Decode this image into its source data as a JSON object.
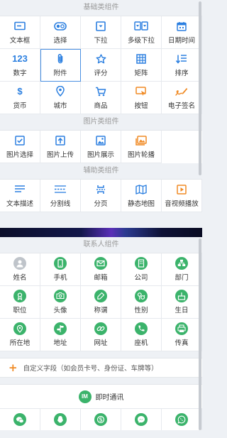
{
  "colors": {
    "accent_blue": "#2b7fe0",
    "accent_orange": "#f08a24",
    "contact_green": "#3bb36b",
    "selected_outline": "#4a90e2"
  },
  "sections": {
    "basic": {
      "title": "基础类组件",
      "items": [
        {
          "label": "文本框",
          "icon": "textbox-icon"
        },
        {
          "label": "选择",
          "icon": "select-toggle-icon"
        },
        {
          "label": "下拉",
          "icon": "dropdown-icon"
        },
        {
          "label": "多级下拉",
          "icon": "multilevel-dropdown-icon"
        },
        {
          "label": "日期时间",
          "icon": "calendar-icon"
        },
        {
          "label": "数字",
          "icon": "number-icon",
          "glyph": "123"
        },
        {
          "label": "附件",
          "icon": "paperclip-icon"
        },
        {
          "label": "评分",
          "icon": "star-icon"
        },
        {
          "label": "矩阵",
          "icon": "matrix-icon"
        },
        {
          "label": "排序",
          "icon": "sort-icon"
        },
        {
          "label": "货币",
          "icon": "currency-icon",
          "glyph": "$"
        },
        {
          "label": "城市",
          "icon": "location-pin-icon"
        },
        {
          "label": "商品",
          "icon": "cart-icon"
        },
        {
          "label": "按钮",
          "icon": "button-click-icon"
        },
        {
          "label": "电子签名",
          "icon": "signature-icon"
        }
      ]
    },
    "image": {
      "title": "图片类组件",
      "items": [
        {
          "label": "图片选择",
          "icon": "image-select-icon"
        },
        {
          "label": "图片上传",
          "icon": "image-upload-icon"
        },
        {
          "label": "图片展示",
          "icon": "image-display-icon"
        },
        {
          "label": "图片轮播",
          "icon": "image-carousel-icon"
        }
      ]
    },
    "aux": {
      "title": "辅助类组件",
      "items": [
        {
          "label": "文本描述",
          "icon": "text-description-icon"
        },
        {
          "label": "分割线",
          "icon": "divider-line-icon"
        },
        {
          "label": "分页",
          "icon": "pagination-icon"
        },
        {
          "label": "静态地图",
          "icon": "static-map-icon"
        },
        {
          "label": "音视频播放",
          "icon": "media-play-icon"
        }
      ]
    },
    "contact": {
      "title": "联系人组件",
      "items": [
        {
          "label": "姓名",
          "icon": "person-icon"
        },
        {
          "label": "手机",
          "icon": "mobile-phone-icon"
        },
        {
          "label": "邮箱",
          "icon": "mail-icon"
        },
        {
          "label": "公司",
          "icon": "company-icon"
        },
        {
          "label": "部门",
          "icon": "department-icon"
        },
        {
          "label": "职位",
          "icon": "position-icon"
        },
        {
          "label": "头像",
          "icon": "avatar-camera-icon"
        },
        {
          "label": "称谓",
          "icon": "title-icon"
        },
        {
          "label": "性别",
          "icon": "gender-icon"
        },
        {
          "label": "生日",
          "icon": "birthday-cake-icon"
        },
        {
          "label": "所在地",
          "icon": "current-location-icon"
        },
        {
          "label": "地址",
          "icon": "address-sign-icon"
        },
        {
          "label": "网址",
          "icon": "link-icon"
        },
        {
          "label": "座机",
          "icon": "landline-phone-icon"
        },
        {
          "label": "传真",
          "icon": "fax-icon"
        }
      ],
      "custom_field": "自定义字段（如会员卡号、身份证、车牌等）"
    },
    "im": {
      "title": "即时通讯",
      "badge": "IM",
      "items": [
        {
          "icon": "wechat-icon"
        },
        {
          "icon": "qq-icon"
        },
        {
          "icon": "skype-icon"
        },
        {
          "icon": "messenger-icon"
        },
        {
          "icon": "whatsapp-icon"
        }
      ]
    }
  }
}
